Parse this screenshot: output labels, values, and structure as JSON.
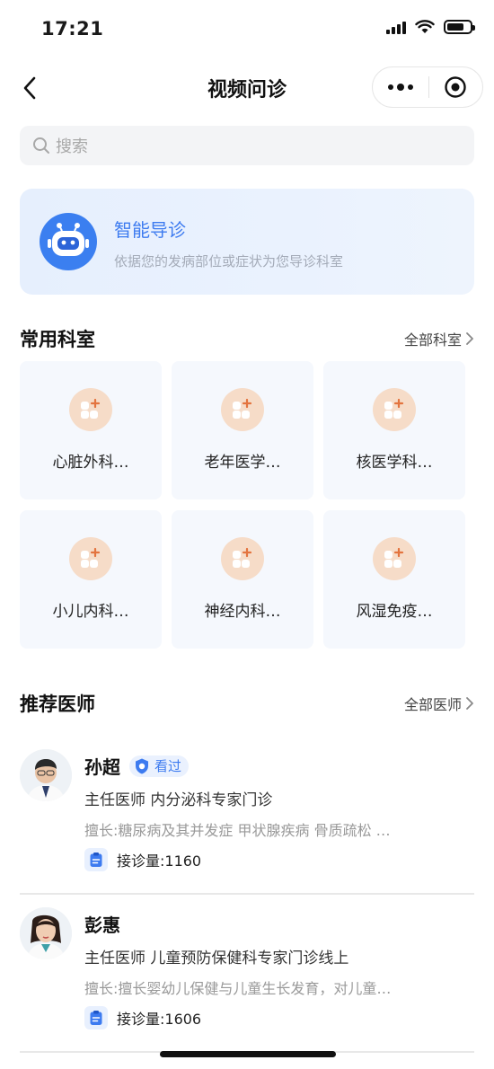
{
  "status_bar": {
    "time": "17:21"
  },
  "nav": {
    "title": "视频问诊"
  },
  "search": {
    "placeholder": "搜索"
  },
  "smart_guide": {
    "title": "智能导诊",
    "subtitle": "依据您的发病部位或症状为您导诊科室"
  },
  "departments": {
    "title": "常用科室",
    "all_link": "全部科室",
    "items": [
      {
        "label": "心脏外科…"
      },
      {
        "label": "老年医学…"
      },
      {
        "label": "核医学科…"
      },
      {
        "label": "小儿内科…"
      },
      {
        "label": "神经内科…"
      },
      {
        "label": "风湿免疫…"
      }
    ]
  },
  "doctors": {
    "title": "推荐医师",
    "all_link": "全部医师",
    "items": [
      {
        "name": "孙超",
        "badge": "看过",
        "title_line": "主任医师  内分泌科专家门诊",
        "skill": "擅长:糖尿病及其并发症 甲状腺疾病 骨质疏松 …",
        "count": "接诊量:1160"
      },
      {
        "name": "彭惠",
        "title_line": "主任医师  儿童预防保健科专家门诊线上",
        "skill": "擅长:擅长婴幼儿保健与儿童生长发育，对儿童…",
        "count": "接诊量:1606"
      }
    ]
  },
  "colors": {
    "accent": "#3d7bf0",
    "dept_icon_bg": "#f6dcc8",
    "dept_icon_fg": "#e69a62"
  },
  "icons": [
    "back-chevron-icon",
    "more-dots-icon",
    "target-icon",
    "search-icon",
    "robot-icon",
    "department-icon",
    "chevron-right-icon",
    "shield-check-icon",
    "clipboard-icon"
  ]
}
